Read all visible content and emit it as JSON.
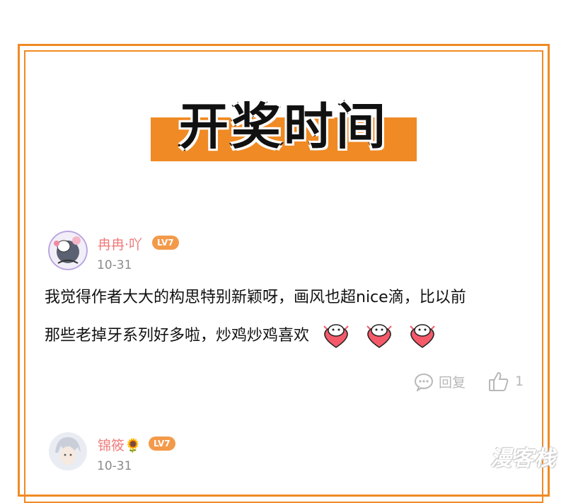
{
  "header": {
    "title": "开奖时间"
  },
  "colors": {
    "accent": "#f08a24",
    "username": "#f07a7a",
    "badge": "#f39a4a",
    "muted": "#b8b8b8"
  },
  "comments": [
    {
      "username": "冉冉·吖",
      "level": "LV7",
      "date": "10-31",
      "text_line1": "我觉得作者大大的构思特别新颖呀，画风也超nice滴，比以前",
      "text_line2": "那些老掉牙系列好多啦，炒鸡炒鸡喜欢",
      "emoji_icon": "heart-face-sticker-icon",
      "reply_label": "回复",
      "like_count": "1"
    },
    {
      "username": "锦筱🌻",
      "level": "LV7",
      "date": "10-31"
    }
  ],
  "watermark": {
    "text": "漫客栈"
  }
}
